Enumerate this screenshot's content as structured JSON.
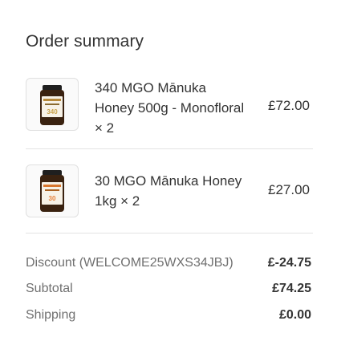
{
  "order_summary": {
    "title": "Order summary",
    "items": [
      {
        "name": "340 MGO Mānuka Honey 500g - Monofloral × 2",
        "price": "£72.00",
        "image_icon": "honey-jar-icon",
        "label_color": "#c9a24a"
      },
      {
        "name": "30 MGO Mānuka Honey 1kg × 2",
        "price": "£27.00",
        "image_icon": "honey-jar-icon",
        "label_color": "#e8823a"
      }
    ],
    "totals": {
      "discount_label": "Discount (WELCOME25WXS34JBJ)",
      "discount_value": "£-24.75",
      "subtotal_label": "Subtotal",
      "subtotal_value": "£74.25",
      "shipping_label": "Shipping",
      "shipping_value": "£0.00"
    }
  }
}
